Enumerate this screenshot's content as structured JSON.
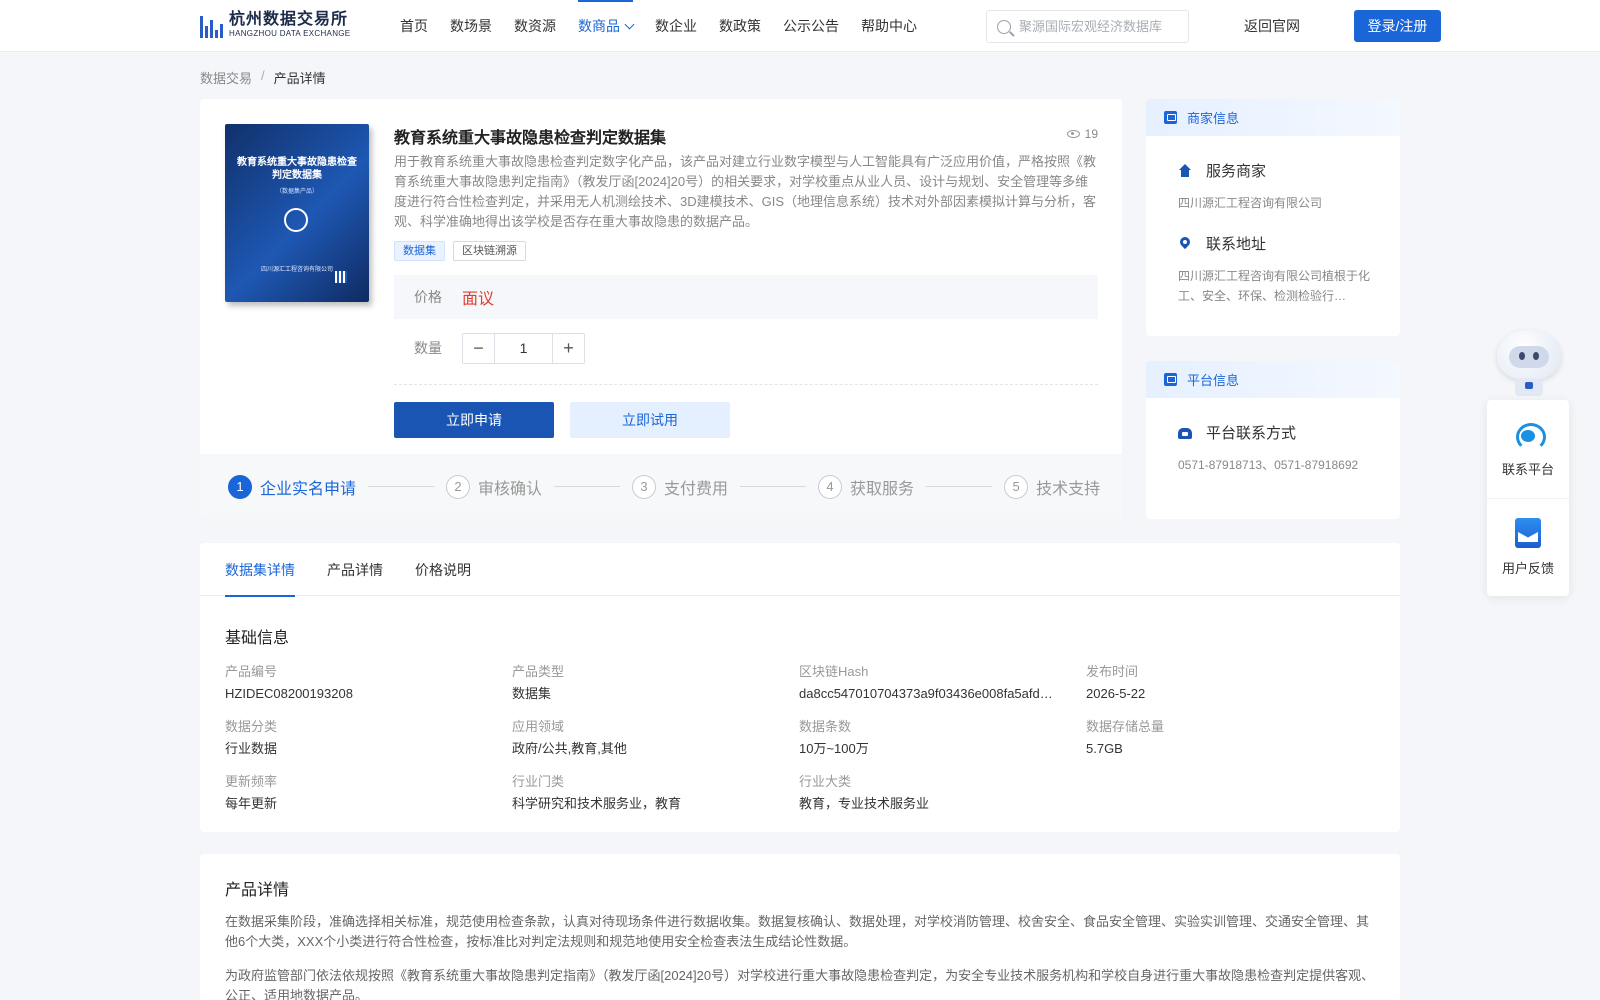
{
  "header": {
    "logo_cn": "杭州数据交易所",
    "logo_en": "HANGZHOU DATA EXCHANGE",
    "nav": [
      "首页",
      "数场景",
      "数资源",
      "数商品",
      "数企业",
      "数政策",
      "公示公告",
      "帮助中心"
    ],
    "active_nav": "数商品",
    "search_placeholder": "聚源国际宏观经济数据库",
    "back_home": "返回官网",
    "login": "登录/注册"
  },
  "breadcrumb": {
    "parent": "数据交易",
    "sep": "/",
    "current": "产品详情"
  },
  "product": {
    "cover_title": "教育系统重大事故隐患检查判定数据集",
    "cover_sub": "（数据集产品）",
    "cover_company": "四川源汇工程咨询有限公司",
    "title": "教育系统重大事故隐患检查判定数据集",
    "views": "19",
    "description": "用于教育系统重大事故隐患检查判定数字化产品，该产品对建立行业数字模型与人工智能具有广泛应用价值，严格按照《教育系统重大事故隐患判定指南》（教发厅函[2024]20号）的相关要求，对学校重点从业人员、设计与规划、安全管理等多维度进行符合性检查判定，并采用无人机测绘技术、3D建模技术、GIS（地理信息系统）技术对外部因素模拟计算与分析，客观、科学准确地得出该学校是否存在重大事故隐患的数据产品。",
    "tags": [
      "数据集",
      "区块链溯源"
    ],
    "price_label": "价格",
    "price_value": "面议",
    "qty_label": "数量",
    "qty_value": "1",
    "minus": "−",
    "plus": "+",
    "apply_btn": "立即申请",
    "trial_btn": "立即试用",
    "steps": [
      {
        "num": "1",
        "label": "企业实名申请"
      },
      {
        "num": "2",
        "label": "审核确认"
      },
      {
        "num": "3",
        "label": "支付费用"
      },
      {
        "num": "4",
        "label": "获取服务"
      },
      {
        "num": "5",
        "label": "技术支持"
      }
    ]
  },
  "merchant": {
    "head": "商家信息",
    "service_title": "服务商家",
    "service_value": "四川源汇工程咨询有限公司",
    "address_title": "联系地址",
    "address_value": "四川源汇工程咨询有限公司植根于化工、安全、环保、检测检验行…"
  },
  "platform": {
    "head": "平台信息",
    "contact_title": "平台联系方式",
    "contact_value": "0571-87918713、0571-87918692"
  },
  "tabs": [
    "数据集详情",
    "产品详情",
    "价格说明"
  ],
  "basic": {
    "title": "基础信息",
    "items": [
      {
        "k": "产品编号",
        "v": "HZIDEC08200193208"
      },
      {
        "k": "产品类型",
        "v": "数据集"
      },
      {
        "k": "区块链Hash",
        "v": "da8cc547010704373a9f03436e008fa5afd…"
      },
      {
        "k": "发布时间",
        "v": "2026-5-22"
      },
      {
        "k": "数据分类",
        "v": "行业数据"
      },
      {
        "k": "应用领域",
        "v": "政府/公共,教育,其他"
      },
      {
        "k": "数据条数",
        "v": "10万~100万"
      },
      {
        "k": "数据存储总量",
        "v": "5.7GB"
      },
      {
        "k": "更新频率",
        "v": "每年更新"
      },
      {
        "k": "行业门类",
        "v": "科学研究和技术服务业，教育"
      },
      {
        "k": "行业大类",
        "v": "教育，专业技术服务业"
      }
    ]
  },
  "detail": {
    "title": "产品详情",
    "p1": "在数据采集阶段，准确选择相关标准，规范使用检查条款，认真对待现场条件进行数据收集。数据复核确认、数据处理，对学校消防管理、校舍安全、食品安全管理、实验实训管理、交通安全管理、其他6个大类，XXX个小类进行符合性检查，按标准比对判定法规则和规范地使用安全检查表法生成结论性数据。",
    "p2": "为政府监管部门依法依规按照《教育系统重大事故隐患判定指南》（教发厅函[2024]20号）对学校进行重大事故隐患检查判定，为安全专业技术服务机构和学校自身进行重大事故隐患检查判定提供客观、公正、适用地数据产品。"
  },
  "float": {
    "contact": "联系平台",
    "feedback": "用户反馈"
  },
  "colors": {
    "primary": "#1a66d9",
    "price": "#e23c30"
  }
}
